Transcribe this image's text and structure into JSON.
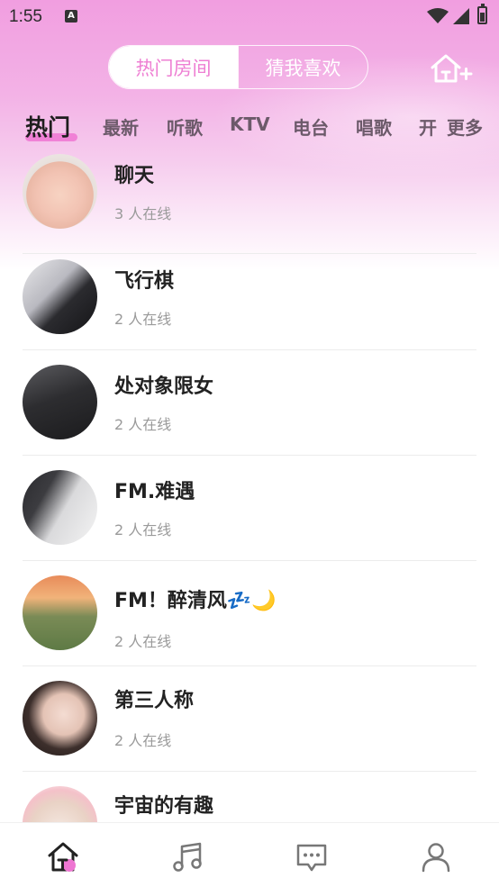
{
  "status_bar": {
    "time": "1:55",
    "notification_icon": "a-letter-icon",
    "wifi": "wifi-icon",
    "signal": "signal-icon",
    "battery": "battery-icon"
  },
  "segments": {
    "active": "热门房间",
    "inactive": "猜我喜欢"
  },
  "header": {
    "create_room_icon": "home-plus-icon"
  },
  "categories": [
    "热门",
    "最新",
    "听歌",
    "KTV",
    "电台",
    "唱歌",
    "开"
  ],
  "more_label": "更多",
  "rooms": [
    {
      "name": "聊天",
      "online": "3 人在线"
    },
    {
      "name": "飞行棋",
      "online": "2 人在线"
    },
    {
      "name": "处对象限女",
      "online": "2 人在线"
    },
    {
      "name": "FM.难遇",
      "online": "2 人在线"
    },
    {
      "name": "FM！醉清风💤🌙",
      "online": "2 人在线"
    },
    {
      "name": "第三人称",
      "online": "2 人在线"
    },
    {
      "name": "宇宙的有趣",
      "online": ""
    }
  ],
  "nav": [
    "home-icon",
    "music-icon",
    "message-icon",
    "profile-icon"
  ],
  "colors": {
    "accent": "#ee76d2",
    "header_pink": "#f19ee0"
  }
}
